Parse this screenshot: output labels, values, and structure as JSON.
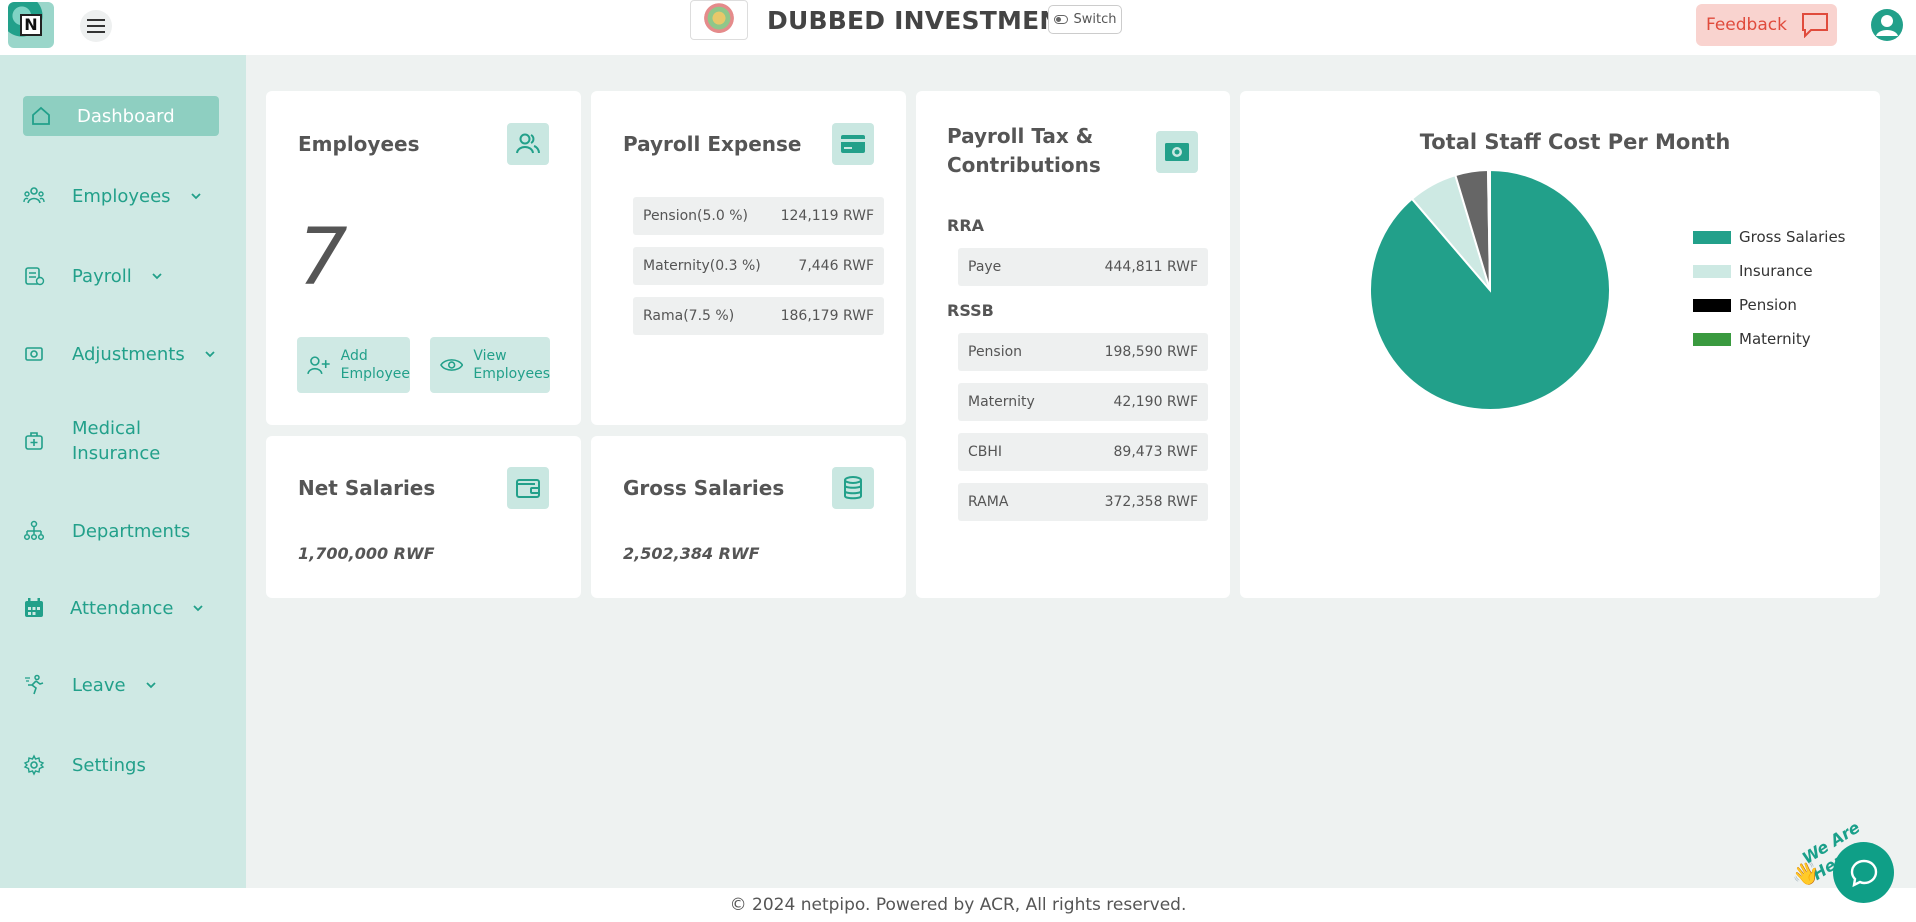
{
  "header": {
    "company_name": "DUBBED INVESTMENTS",
    "switch_label": "Switch",
    "feedback_label": "Feedback"
  },
  "sidebar": {
    "items": [
      {
        "label": "Dashboard",
        "icon": "home-icon",
        "active": true
      },
      {
        "label": "Employees",
        "icon": "people-icon",
        "has_submenu": true
      },
      {
        "label": "Payroll",
        "icon": "payroll-icon",
        "has_submenu": true
      },
      {
        "label": "Adjustments",
        "icon": "money-icon",
        "has_submenu": true
      },
      {
        "label": "Medical\nInsurance",
        "icon": "medical-case-icon"
      },
      {
        "label": "Departments",
        "icon": "org-chart-icon"
      },
      {
        "label": "Attendance",
        "icon": "calendar-icon",
        "has_submenu": true
      },
      {
        "label": "Leave",
        "icon": "running-person-icon",
        "has_submenu": true
      },
      {
        "label": "Settings",
        "icon": "gear-icon"
      }
    ]
  },
  "employees_card": {
    "title": "Employees",
    "count": "7",
    "add_label": "Add\nEmployee",
    "view_label": "View\nEmployees"
  },
  "payroll_expense": {
    "title": "Payroll Expense",
    "rows": [
      {
        "label": "Pension(5.0 %)",
        "value": "124,119 RWF"
      },
      {
        "label": "Maternity(0.3 %)",
        "value": "7,446 RWF"
      },
      {
        "label": "Rama(7.5 %)",
        "value": "186,179 RWF"
      }
    ]
  },
  "payroll_tax": {
    "title": "Payroll Tax &\nContributions",
    "rra_label": "RRA",
    "rra_rows": [
      {
        "label": "Paye",
        "value": "444,811 RWF"
      }
    ],
    "rssb_label": "RSSB",
    "rssb_rows": [
      {
        "label": "Pension",
        "value": "198,590 RWF"
      },
      {
        "label": "Maternity",
        "value": "42,190 RWF"
      },
      {
        "label": "CBHI",
        "value": "89,473 RWF"
      },
      {
        "label": "RAMA",
        "value": "372,358 RWF"
      }
    ]
  },
  "net_salaries": {
    "title": "Net Salaries",
    "value": "1,700,000 RWF"
  },
  "gross_salaries": {
    "title": "Gross Salaries",
    "value": "2,502,384 RWF"
  },
  "chart_data": {
    "type": "pie",
    "title": "Total Staff Cost Per Month",
    "legend_position": "right",
    "series": [
      {
        "name": "Gross Salaries",
        "value": 2502384,
        "color": "#22a08a"
      },
      {
        "name": "Insurance",
        "value": 186179,
        "color": "#cde9e3"
      },
      {
        "name": "Pension",
        "value": 124119,
        "color": "#666666",
        "legend_color": "#000000"
      },
      {
        "name": "Maternity",
        "value": 7446,
        "color": "#3a9a3f"
      }
    ]
  },
  "footer": {
    "text": "© 2024 netpipo. Powered by ACR, All rights reserved."
  },
  "chat": {
    "tagline": "We Are Here!"
  }
}
